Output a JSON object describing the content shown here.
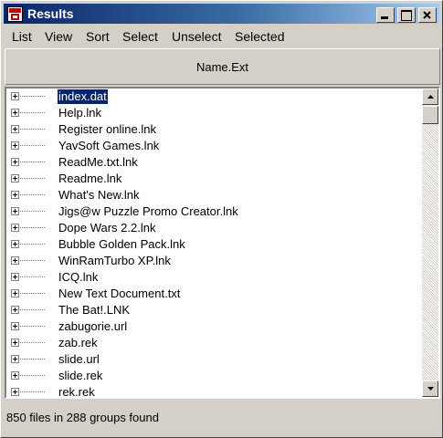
{
  "window": {
    "title": "Results"
  },
  "menu": {
    "items": [
      {
        "label": "List"
      },
      {
        "label": "View"
      },
      {
        "label": "Sort"
      },
      {
        "label": "Select"
      },
      {
        "label": "Unselect"
      },
      {
        "label": "Selected"
      }
    ]
  },
  "column_header": {
    "label": "Name.Ext"
  },
  "files": [
    {
      "name": "index.dat",
      "selected": true
    },
    {
      "name": "Help.lnk"
    },
    {
      "name": "Register online.lnk"
    },
    {
      "name": "YavSoft Games.lnk"
    },
    {
      "name": "ReadMe.txt.lnk"
    },
    {
      "name": "Readme.lnk"
    },
    {
      "name": "What's New.lnk"
    },
    {
      "name": "Jigs@w Puzzle Promo Creator.lnk"
    },
    {
      "name": "Dope Wars 2.2.lnk"
    },
    {
      "name": "Bubble Golden Pack.lnk"
    },
    {
      "name": "WinRamTurbo XP.lnk"
    },
    {
      "name": "ICQ.lnk"
    },
    {
      "name": "New Text Document.txt"
    },
    {
      "name": "The Bat!.LNK"
    },
    {
      "name": "zabugorie.url"
    },
    {
      "name": "zab.rek"
    },
    {
      "name": "slide.url"
    },
    {
      "name": "slide.rek"
    },
    {
      "name": "rek.rek"
    }
  ],
  "status": {
    "text": "850 files in 288 groups found"
  },
  "icons": {
    "app": "app-icon",
    "minimize": "minimize-icon",
    "maximize": "maximize-icon",
    "close": "close-icon",
    "expand": "expand-plus-icon",
    "scroll_up": "scroll-up-arrow-icon",
    "scroll_down": "scroll-down-arrow-icon"
  },
  "colors": {
    "titlebar_start": "#0a246a",
    "titlebar_end": "#a6caf0",
    "selection": "#0a246a",
    "face": "#d4d0c8"
  }
}
